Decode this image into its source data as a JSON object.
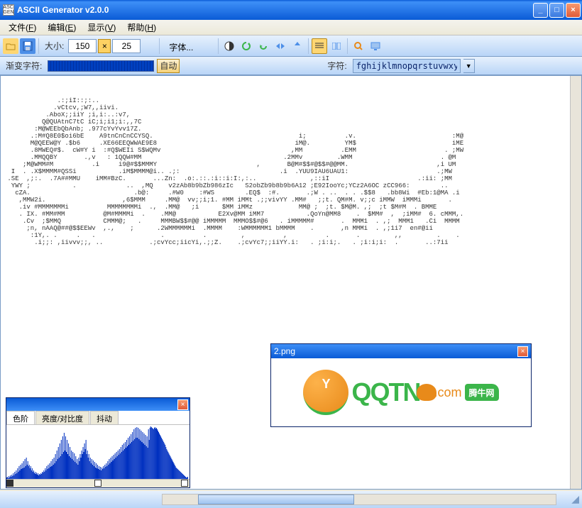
{
  "title": "ASCII Generator v2.0.0",
  "titlebar_icon": "ASC GEN",
  "menu": {
    "file": "文件",
    "file_u": "F",
    "edit": "编辑",
    "edit_u": "E",
    "view": "显示",
    "view_u": "V",
    "help": "帮助",
    "help_u": "H"
  },
  "toolbar": {
    "size_label": "大小:",
    "width": "150",
    "height": "25",
    "x": "×",
    "font_label": "字体..."
  },
  "ctrlbar": {
    "gradient_label": "渐变字符:",
    "auto": "自动",
    "chars_label": "字符:",
    "chars_value": "fghijklmnopqrstuvwxyz#"
  },
  "ascii_art": "              .:;iI::;:..\n             .vCtcv,;W7,,iivi.\n           .AboX;;iiY ;i,i:..:v7,\n          Q@QUAtnC7tC iC;i;i1;i:,,7C\n        :M@WEEbQbAnb; .977cYvYvv17Z.\n       .:M#Q8E0$oi6bE    A9tnCnCnCCYSQ.                                      i;          .v.                         :M@\n       M@QEEW@Y .$b6     .XE66EEQWWAE9E8                                    iM@.         YM$                         iME\n       .8MWEQ#$.  cW#Y i  :#Q$WEIi S$WQMv                                  ,MM          .EMM                       . ;MW\n       .MMQQBY       .,v   : 1QQW#MM                                     .2MMv         .WMM                       . @M\n     ;M@WMM#M          .i     i9@#$$MMMY                          ,       B@M#$$#@$$#@@MM.                       ,i UM\n  I  . .X$MMMM#QSSi           .iM$MMMM@i.. .;:                          .i  .YUU9IAU6UAU1:                       .;MW\n .SE  ,;:.  .7A##MMU    iMM#BzC.       ...Zn:  .o:.::.:i::i:I:,:..              ,::iI                       .:ii: ;MM\n  YWY ;           .             ..  ,MQ    v2zAb8b9bZb986zIc   S2obZb9b8b9b6A12 ;E92IooYc;YCz2A6OC zCC966:        ..\n   cZA.                           .b@:     .#W0    :#WS        .EQ$  :#.       .;W . ..  . . .$$8   .bb8Wi  #Eb:1@MA .i\n    ,MMW2i.                    ,6$MMM     .MM@  vv;;i;1. #MM iMMt .;;vivYY .MM#   ;;t. QM#M. v;;c iMMW  iMMMi       .\n    .iv #MMMMMMMi          MMMMMMMMi  .,  .MM@   ;i      $MM iMMz            MM@ ;  ;t. $M@M. ,;  ;t $M#M  . BMME\n    . IX. #MM#MM          @M#MMMMi  .    .MM@           E2Xv@MM iMM7           .QoYn@MM8    .  $MM#  ,  ;iMM#  6. cMMM,.\n     .Cv  ;$MMQ           CMMM@;   .     MMMBW$$#@@ iMMMMM  MMMO$$#@6   . iMMMMM#       .  MMM1  . ,;  MMM1   .Ci  MMMM\n      ;n, nAAQ@##@$$EEWv  ,.,    ;      .2WMMMMMMi  .MMMM    :WMMMMMM1 bMMMM    .       ,n MMMi  . ,;1i7  en#@ii\n       :1Y,. .     .   .                 .          .         ,          ,          .       .         ,,         .    .\n        .i;;: ,iivvv;;, ..            .;cvYcc;iicYi,.;;Z.    .;cvYc7;;iiYY.i:   . ;i:i;.   . ;i:i;i:  .       ..:7ii",
  "histogram": {
    "tab1": "色阶",
    "tab2": "亮度/对比度",
    "tab3": "抖动",
    "data": [
      2,
      3,
      1,
      4,
      2,
      5,
      3,
      6,
      4,
      8,
      5,
      10,
      7,
      12,
      8,
      15,
      10,
      18,
      12,
      20,
      14,
      22,
      15,
      25,
      16,
      28,
      18,
      30,
      20,
      25,
      18,
      20,
      15,
      18,
      12,
      15,
      10,
      12,
      8,
      10,
      7,
      9,
      6,
      8,
      5,
      7,
      6,
      8,
      7,
      10,
      9,
      12,
      10,
      15,
      12,
      18,
      14,
      20,
      15,
      22,
      17,
      25,
      18,
      28,
      20,
      30,
      22,
      35,
      25,
      40,
      28,
      45,
      30,
      50,
      32,
      55,
      35,
      60,
      38,
      65,
      40,
      60,
      38,
      55,
      35,
      50,
      32,
      45,
      30,
      40,
      28,
      38,
      26,
      36,
      24,
      32,
      22,
      28,
      20,
      30,
      25,
      35,
      30,
      40,
      35,
      45,
      38,
      50,
      42,
      55,
      35,
      40,
      30,
      35,
      25,
      30,
      22,
      28,
      20,
      26,
      18,
      24,
      16,
      22,
      15,
      20,
      14,
      18,
      13,
      17,
      12,
      16,
      14,
      18,
      15,
      20,
      17,
      22,
      18,
      25,
      20,
      28,
      22,
      30,
      24,
      32,
      26,
      34,
      28,
      36,
      30,
      38,
      32,
      40,
      34,
      42,
      36,
      45,
      38,
      48,
      40,
      50,
      42,
      52,
      44,
      55,
      46,
      58,
      48,
      60,
      50,
      63,
      52,
      66,
      54,
      70,
      56,
      72,
      58,
      73,
      58,
      72,
      56,
      70,
      54,
      68,
      52,
      66,
      50,
      64,
      48,
      62,
      46,
      60,
      44,
      70,
      55,
      72,
      74,
      73,
      72,
      71,
      70,
      72,
      73,
      71,
      72,
      70,
      68,
      66,
      64,
      62,
      60,
      58,
      56,
      54,
      52,
      50,
      48,
      45,
      42,
      40,
      38,
      36,
      34,
      32,
      30,
      28,
      26,
      24,
      22,
      20,
      18,
      16,
      15,
      14,
      13,
      12,
      11,
      10,
      9,
      8,
      7,
      6,
      5,
      4,
      3,
      2,
      2,
      3
    ]
  },
  "preview": {
    "title": "2.png",
    "logo_brand": "QQTN",
    "logo_suffix": ".com",
    "badge": "腾牛网",
    "horn": "Y"
  },
  "colors": {
    "title_bg": "#0A5BD6",
    "toolbar_bg": "#B9D5F7",
    "accent_orange": "#E88A1A",
    "accent_green": "#3BB54A"
  }
}
